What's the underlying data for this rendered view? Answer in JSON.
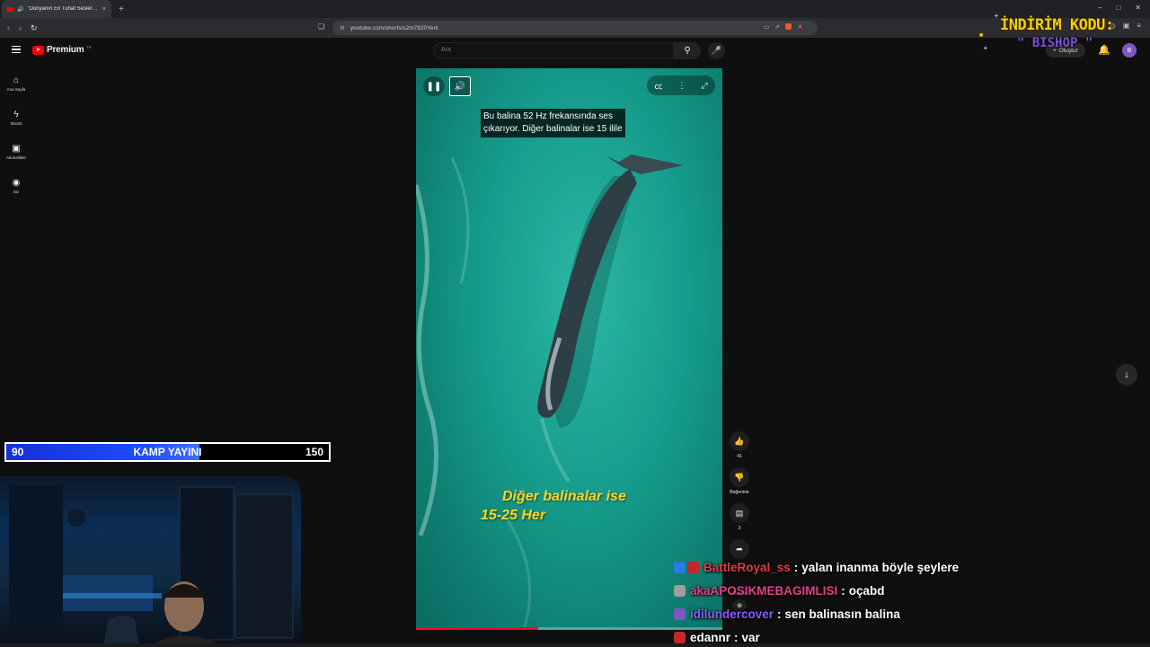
{
  "browser": {
    "tab_title": "\"Dünyanın En Tuhaf Sesleri: S",
    "tab_close": "×",
    "new_tab": "+",
    "url": "youtube.com/shorts/s2m7820Yerk"
  },
  "masthead": {
    "logo_text": "Premium",
    "logo_region": "TR",
    "search_placeholder": "Ara",
    "create_label": "Oluştur",
    "avatar_letter": "B"
  },
  "promo": {
    "line1": "İNDİRİM KODU:",
    "line2": "\" BISHOP \""
  },
  "sidenav": {
    "items": [
      {
        "label": "Ana Sayfa",
        "icon": "home-icon"
      },
      {
        "label": "Shorts",
        "icon": "shorts-icon"
      },
      {
        "label": "Abonelikler",
        "icon": "subscriptions-icon"
      },
      {
        "label": "Siz",
        "icon": "you-icon"
      }
    ]
  },
  "video": {
    "caption_line1": "Bu balina 52 Hz frekansında ses",
    "caption_line2": "çıkarıyor. Diğer balinalar ise 15 ilile",
    "subtitle_line1": "Diğer balinalar ise",
    "subtitle_line2": "15-25 Her",
    "progress": 0.4
  },
  "actions": {
    "like_count": "41",
    "dislike_label": "Beğenme",
    "comment_count": "3",
    "remix_label": "Remix"
  },
  "stream": {
    "kamp_label": "KAMP YAYINI",
    "kamp_current": "90",
    "kamp_goal": "150",
    "kamp_progress": 0.6
  },
  "chat": [
    {
      "user": "BattleRoyal_ss",
      "sep": ":",
      "text": "yalan inanma böyle şeylere",
      "color": "#e23a4a",
      "badge_colors": [
        "#2a7be4",
        "#c62828"
      ]
    },
    {
      "user": "akaAPOSIKMEBAGIMLISI",
      "sep": ":",
      "text": "oçabd",
      "color": "#e0418a",
      "badge_colors": [
        "#9e9e9e"
      ]
    },
    {
      "user": "idilundercover",
      "sep": ":",
      "text": "sen balinasın balina",
      "color": "#8a5cff",
      "badge_colors": [
        "#7e57c2"
      ]
    },
    {
      "user": "edannr",
      "sep": ":",
      "text": "var",
      "color": "#ffffff",
      "badge_colors": [
        "#c62828"
      ]
    }
  ]
}
